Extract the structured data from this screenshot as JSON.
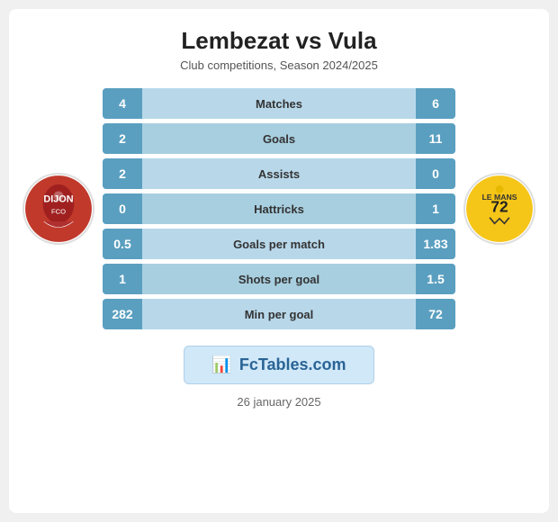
{
  "header": {
    "title": "Lembezat vs Vula",
    "subtitle": "Club competitions, Season 2024/2025"
  },
  "team_left": {
    "name": "DFCO",
    "label": "DFCO"
  },
  "team_right": {
    "name": "Le Mans 72",
    "label": "Le Mans 72"
  },
  "stats": [
    {
      "label": "Matches",
      "left": "4",
      "right": "6"
    },
    {
      "label": "Goals",
      "left": "2",
      "right": "11"
    },
    {
      "label": "Assists",
      "left": "2",
      "right": "0"
    },
    {
      "label": "Hattricks",
      "left": "0",
      "right": "1"
    },
    {
      "label": "Goals per match",
      "left": "0.5",
      "right": "1.83"
    },
    {
      "label": "Shots per goal",
      "left": "1",
      "right": "1.5"
    },
    {
      "label": "Min per goal",
      "left": "282",
      "right": "72"
    }
  ],
  "banner": {
    "icon": "📊",
    "text": "FcTables.com"
  },
  "date": "26 january 2025"
}
